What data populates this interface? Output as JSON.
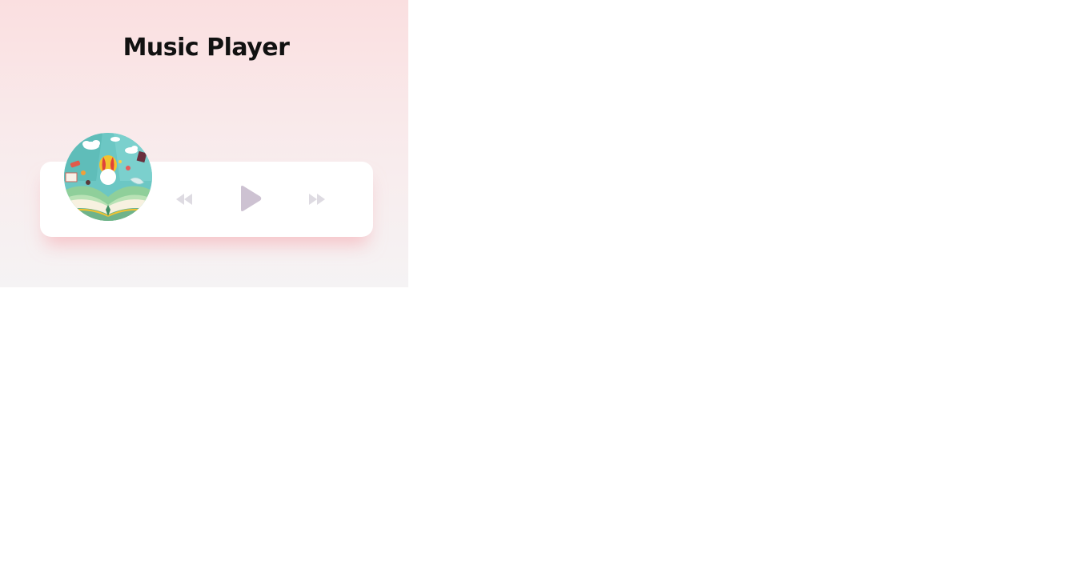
{
  "app": {
    "title": "Music Player"
  },
  "player": {
    "controls": {
      "prev_icon": "backward-icon",
      "play_icon": "play-icon",
      "next_icon": "forward-icon"
    },
    "album_art_icon": "open-storybook-illustration"
  },
  "colors": {
    "background_top": "#fadfe0",
    "background_bottom": "#f5f3f4",
    "card": "#ffffff",
    "card_shadow": "#f6a0a8",
    "play_button": "#cdc2d2",
    "skip_buttons": "#dedbe2"
  }
}
